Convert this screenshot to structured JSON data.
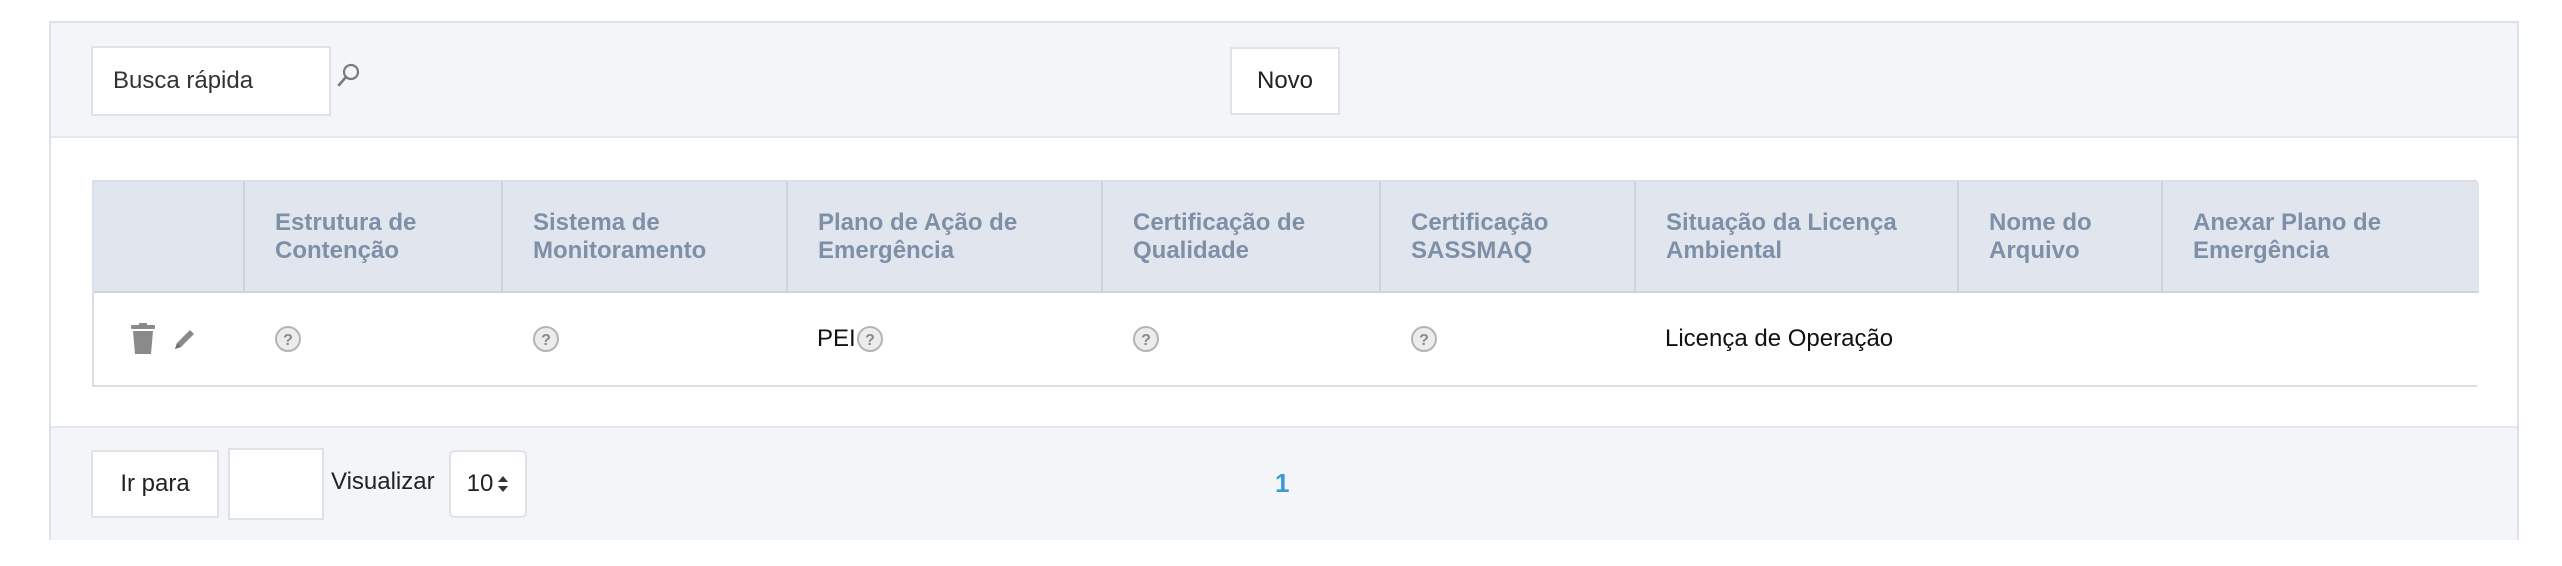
{
  "toolbar": {
    "search_placeholder": "Busca rápida",
    "new_button": "Novo"
  },
  "table": {
    "columns": [
      "",
      "Estrutura de Contenção",
      "Sistema de Monitoramento",
      "Plano de Ação de Emergência",
      "Certificação de Qualidade",
      "Certificação SASSMAQ",
      "Situação da Licença Ambiental",
      "Nome do Arquivo",
      "Anexar Plano de Emergência"
    ],
    "rows": [
      {
        "estrutura": "",
        "sistema": "",
        "plano": "PEI",
        "qualidade": "",
        "sassmaq": "",
        "licenca": "Licença de Operação",
        "arquivo": "",
        "anexar": ""
      }
    ]
  },
  "footer": {
    "goto_label": "Ir para",
    "goto_value": "",
    "view_label": "Visualizar",
    "page_size": "10",
    "current_page": "1"
  },
  "icons": {
    "search": "search-icon",
    "delete": "trash-icon",
    "edit": "pencil-icon",
    "help": "question-circle-icon",
    "sort": "sort-arrows-icon"
  },
  "colors": {
    "header_text": "#7e8fa8",
    "header_bg": "#e1e6ee",
    "page_link": "#3a9bd8",
    "panel_bg": "#f3f5f8"
  }
}
